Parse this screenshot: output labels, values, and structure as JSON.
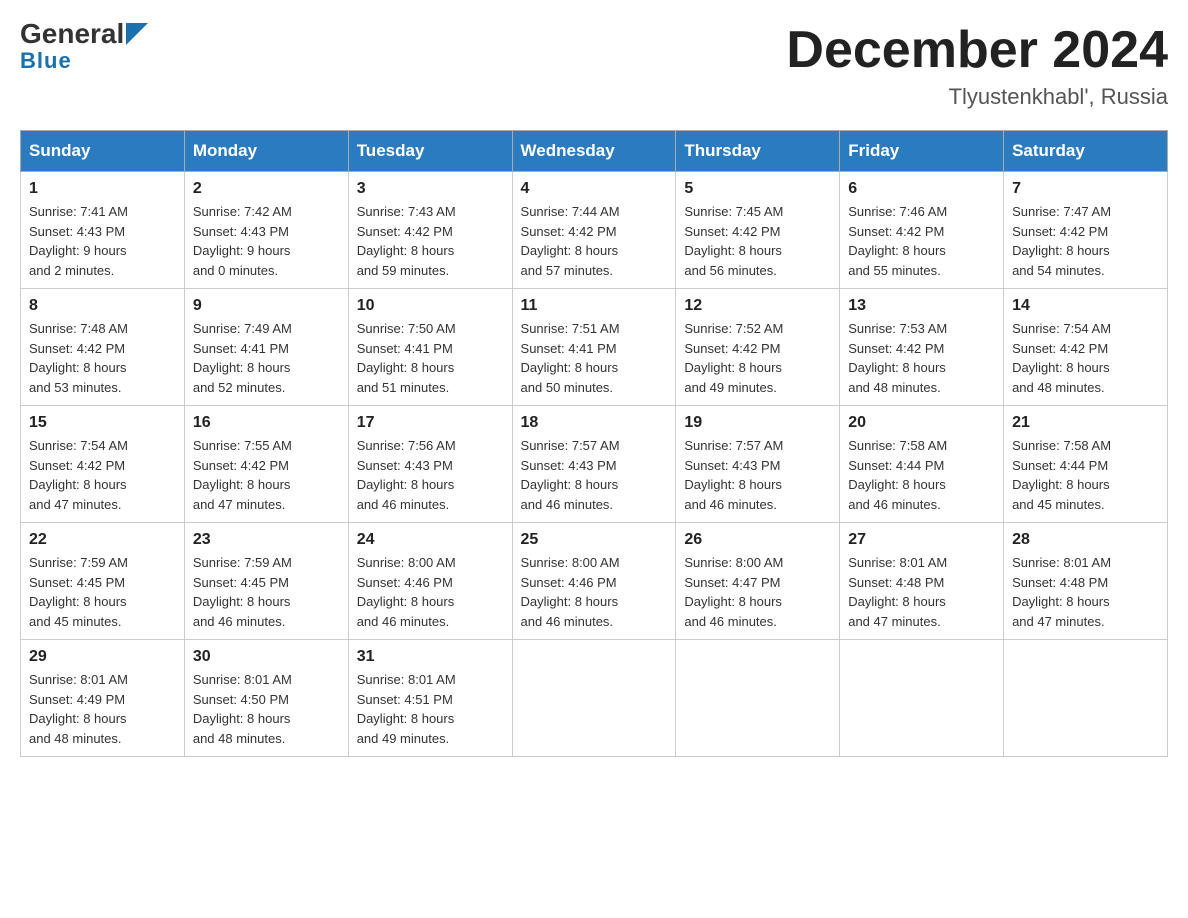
{
  "header": {
    "logo_general": "General",
    "logo_blue": "Blue",
    "month_title": "December 2024",
    "location": "Tlyustenkhabl', Russia"
  },
  "weekdays": [
    "Sunday",
    "Monday",
    "Tuesday",
    "Wednesday",
    "Thursday",
    "Friday",
    "Saturday"
  ],
  "weeks": [
    [
      {
        "day": "1",
        "sunrise": "7:41 AM",
        "sunset": "4:43 PM",
        "daylight": "9 hours and 2 minutes."
      },
      {
        "day": "2",
        "sunrise": "7:42 AM",
        "sunset": "4:43 PM",
        "daylight": "9 hours and 0 minutes."
      },
      {
        "day": "3",
        "sunrise": "7:43 AM",
        "sunset": "4:42 PM",
        "daylight": "8 hours and 59 minutes."
      },
      {
        "day": "4",
        "sunrise": "7:44 AM",
        "sunset": "4:42 PM",
        "daylight": "8 hours and 57 minutes."
      },
      {
        "day": "5",
        "sunrise": "7:45 AM",
        "sunset": "4:42 PM",
        "daylight": "8 hours and 56 minutes."
      },
      {
        "day": "6",
        "sunrise": "7:46 AM",
        "sunset": "4:42 PM",
        "daylight": "8 hours and 55 minutes."
      },
      {
        "day": "7",
        "sunrise": "7:47 AM",
        "sunset": "4:42 PM",
        "daylight": "8 hours and 54 minutes."
      }
    ],
    [
      {
        "day": "8",
        "sunrise": "7:48 AM",
        "sunset": "4:42 PM",
        "daylight": "8 hours and 53 minutes."
      },
      {
        "day": "9",
        "sunrise": "7:49 AM",
        "sunset": "4:41 PM",
        "daylight": "8 hours and 52 minutes."
      },
      {
        "day": "10",
        "sunrise": "7:50 AM",
        "sunset": "4:41 PM",
        "daylight": "8 hours and 51 minutes."
      },
      {
        "day": "11",
        "sunrise": "7:51 AM",
        "sunset": "4:41 PM",
        "daylight": "8 hours and 50 minutes."
      },
      {
        "day": "12",
        "sunrise": "7:52 AM",
        "sunset": "4:42 PM",
        "daylight": "8 hours and 49 minutes."
      },
      {
        "day": "13",
        "sunrise": "7:53 AM",
        "sunset": "4:42 PM",
        "daylight": "8 hours and 48 minutes."
      },
      {
        "day": "14",
        "sunrise": "7:54 AM",
        "sunset": "4:42 PM",
        "daylight": "8 hours and 48 minutes."
      }
    ],
    [
      {
        "day": "15",
        "sunrise": "7:54 AM",
        "sunset": "4:42 PM",
        "daylight": "8 hours and 47 minutes."
      },
      {
        "day": "16",
        "sunrise": "7:55 AM",
        "sunset": "4:42 PM",
        "daylight": "8 hours and 47 minutes."
      },
      {
        "day": "17",
        "sunrise": "7:56 AM",
        "sunset": "4:43 PM",
        "daylight": "8 hours and 46 minutes."
      },
      {
        "day": "18",
        "sunrise": "7:57 AM",
        "sunset": "4:43 PM",
        "daylight": "8 hours and 46 minutes."
      },
      {
        "day": "19",
        "sunrise": "7:57 AM",
        "sunset": "4:43 PM",
        "daylight": "8 hours and 46 minutes."
      },
      {
        "day": "20",
        "sunrise": "7:58 AM",
        "sunset": "4:44 PM",
        "daylight": "8 hours and 46 minutes."
      },
      {
        "day": "21",
        "sunrise": "7:58 AM",
        "sunset": "4:44 PM",
        "daylight": "8 hours and 45 minutes."
      }
    ],
    [
      {
        "day": "22",
        "sunrise": "7:59 AM",
        "sunset": "4:45 PM",
        "daylight": "8 hours and 45 minutes."
      },
      {
        "day": "23",
        "sunrise": "7:59 AM",
        "sunset": "4:45 PM",
        "daylight": "8 hours and 46 minutes."
      },
      {
        "day": "24",
        "sunrise": "8:00 AM",
        "sunset": "4:46 PM",
        "daylight": "8 hours and 46 minutes."
      },
      {
        "day": "25",
        "sunrise": "8:00 AM",
        "sunset": "4:46 PM",
        "daylight": "8 hours and 46 minutes."
      },
      {
        "day": "26",
        "sunrise": "8:00 AM",
        "sunset": "4:47 PM",
        "daylight": "8 hours and 46 minutes."
      },
      {
        "day": "27",
        "sunrise": "8:01 AM",
        "sunset": "4:48 PM",
        "daylight": "8 hours and 47 minutes."
      },
      {
        "day": "28",
        "sunrise": "8:01 AM",
        "sunset": "4:48 PM",
        "daylight": "8 hours and 47 minutes."
      }
    ],
    [
      {
        "day": "29",
        "sunrise": "8:01 AM",
        "sunset": "4:49 PM",
        "daylight": "8 hours and 48 minutes."
      },
      {
        "day": "30",
        "sunrise": "8:01 AM",
        "sunset": "4:50 PM",
        "daylight": "8 hours and 48 minutes."
      },
      {
        "day": "31",
        "sunrise": "8:01 AM",
        "sunset": "4:51 PM",
        "daylight": "8 hours and 49 minutes."
      },
      null,
      null,
      null,
      null
    ]
  ],
  "labels": {
    "sunrise": "Sunrise: ",
    "sunset": "Sunset: ",
    "daylight": "Daylight: "
  }
}
